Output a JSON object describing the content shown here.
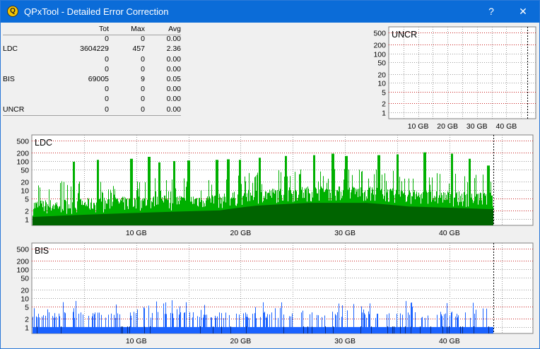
{
  "window": {
    "title": "QPxTool - Detailed Error Correction",
    "app_icon_letter": "Q",
    "help_label": "?",
    "close_label": "✕"
  },
  "stats": {
    "headers": [
      "",
      "Tot",
      "Max",
      "Avg"
    ],
    "rows": [
      {
        "label": "",
        "tot": "0",
        "max": "0",
        "avg": "0.00"
      },
      {
        "label": "LDC",
        "tot": "3604229",
        "max": "457",
        "avg": "2.36"
      },
      {
        "label": "",
        "tot": "0",
        "max": "0",
        "avg": "0.00"
      },
      {
        "label": "",
        "tot": "0",
        "max": "0",
        "avg": "0.00"
      },
      {
        "label": "BIS",
        "tot": "69005",
        "max": "9",
        "avg": "0.05"
      },
      {
        "label": "",
        "tot": "0",
        "max": "0",
        "avg": "0.00"
      },
      {
        "label": "",
        "tot": "0",
        "max": "0",
        "avg": "0.00"
      },
      {
        "label": "UNCR",
        "tot": "0",
        "max": "0",
        "avg": "0.00"
      }
    ]
  },
  "chart_data": [
    {
      "type": "bar",
      "title": "UNCR",
      "y_scale": "log",
      "yticks": [
        "500",
        "200",
        "100",
        "50",
        "20",
        "10",
        "5",
        "2",
        "1"
      ],
      "yvalues": [
        500,
        200,
        100,
        50,
        20,
        10,
        5,
        2,
        1
      ],
      "xticks": [
        "10 GB",
        "20 GB",
        "30 GB",
        "40 GB"
      ],
      "xvalues": [
        10,
        20,
        30,
        40
      ],
      "xlim": [
        0,
        50
      ],
      "end_marker_gb": 47.2,
      "series": [
        {
          "values": []
        }
      ],
      "color": "#00a000"
    },
    {
      "type": "bar",
      "title": "LDC",
      "y_scale": "log",
      "yticks": [
        "500",
        "200",
        "100",
        "50",
        "20",
        "10",
        "5",
        "2",
        "1"
      ],
      "yvalues": [
        500,
        200,
        100,
        50,
        20,
        10,
        5,
        2,
        1
      ],
      "xticks": [
        "10 GB",
        "20 GB",
        "30 GB",
        "40 GB"
      ],
      "xvalues": [
        10,
        20,
        30,
        40
      ],
      "xlim": [
        0,
        48
      ],
      "end_marker_gb": 44.2,
      "data_end_gb": 44.2,
      "max": 457,
      "color": "#00b000",
      "color_dark": "#006400",
      "base_profile": [
        [
          0,
          1.3
        ],
        [
          10,
          1.8
        ],
        [
          18,
          2.2
        ],
        [
          21.5,
          3.2
        ],
        [
          26.5,
          4.0
        ],
        [
          32,
          4.0
        ],
        [
          36,
          3.0
        ],
        [
          44.2,
          2.4
        ]
      ],
      "peaks": [
        [
          4.0,
          95
        ],
        [
          6.3,
          110
        ],
        [
          9.5,
          120
        ],
        [
          11.2,
          140
        ],
        [
          12.2,
          90
        ],
        [
          13.6,
          100
        ],
        [
          15.0,
          105
        ],
        [
          17.7,
          110
        ],
        [
          18.8,
          115
        ],
        [
          19.9,
          110
        ],
        [
          21.8,
          130
        ],
        [
          24.3,
          150
        ],
        [
          27.0,
          160
        ],
        [
          28.8,
          180
        ],
        [
          30.1,
          150
        ],
        [
          33.2,
          160
        ],
        [
          35.0,
          170
        ],
        [
          37.6,
          200
        ],
        [
          40.2,
          180
        ],
        [
          41.9,
          120
        ],
        [
          43.7,
          70
        ]
      ]
    },
    {
      "type": "bar",
      "title": "BIS",
      "y_scale": "log",
      "yticks": [
        "500",
        "200",
        "100",
        "50",
        "20",
        "10",
        "5",
        "2",
        "1"
      ],
      "yvalues": [
        500,
        200,
        100,
        50,
        20,
        10,
        5,
        2,
        1
      ],
      "xticks": [
        "10 GB",
        "20 GB",
        "30 GB",
        "40 GB"
      ],
      "xvalues": [
        10,
        20,
        30,
        40
      ],
      "xlim": [
        0,
        48
      ],
      "end_marker_gb": 44.2,
      "data_end_gb": 44.2,
      "max": 9,
      "color": "#1a62ff",
      "color_dark": "#0a2a7a"
    }
  ]
}
